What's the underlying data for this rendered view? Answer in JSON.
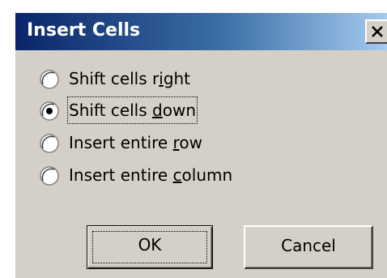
{
  "dialog": {
    "title": "Insert Cells",
    "close_label": "X"
  },
  "options": [
    {
      "label_pre": "Shift cells ",
      "label_key": "i",
      "label_post": "ght",
      "selected": false
    },
    {
      "label_pre": "Shift cells ",
      "label_key": "d",
      "label_post": "own",
      "selected": true
    },
    {
      "label_pre": "Insert entire ",
      "label_key": "r",
      "label_post": "ow",
      "selected": false
    },
    {
      "label_pre": "Insert entire ",
      "label_key": "c",
      "label_post": "olumn",
      "selected": false
    }
  ],
  "buttons": {
    "ok_label": "OK",
    "cancel_label": "Cancel"
  },
  "colors": {
    "titlebar_start": "#0a246a",
    "titlebar_end": "#a6caf0",
    "dialog_face": "#d4d0c8"
  },
  "icons": {
    "close": "close-icon",
    "radio": "radio-button-icon"
  }
}
